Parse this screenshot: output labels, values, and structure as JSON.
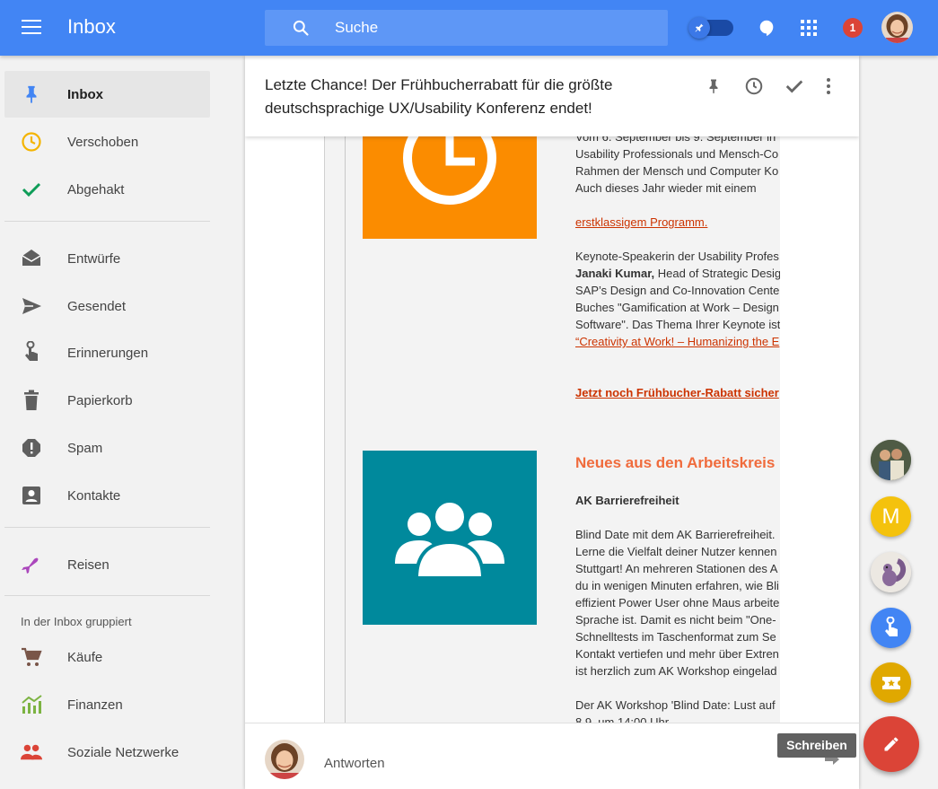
{
  "topbar": {
    "title": "Inbox",
    "search_placeholder": "Suche",
    "notification_count": "1",
    "colors": {
      "bar": "#4285f4",
      "search": "#5e97f6",
      "badge": "#db4437"
    }
  },
  "sidebar": {
    "items": [
      {
        "label": "Inbox",
        "icon": "pin-icon",
        "active": true
      },
      {
        "label": "Verschoben",
        "icon": "clock-icon"
      },
      {
        "label": "Abgehakt",
        "icon": "check-icon"
      },
      {
        "label": "Entwürfe",
        "icon": "drafts-icon"
      },
      {
        "label": "Gesendet",
        "icon": "send-icon"
      },
      {
        "label": "Erinnerungen",
        "icon": "reminder-icon"
      },
      {
        "label": "Papierkorb",
        "icon": "trash-icon"
      },
      {
        "label": "Spam",
        "icon": "spam-icon"
      },
      {
        "label": "Kontakte",
        "icon": "contacts-icon"
      },
      {
        "label": "Reisen",
        "icon": "plane-icon"
      },
      {
        "label": "Käufe",
        "icon": "cart-icon"
      },
      {
        "label": "Finanzen",
        "icon": "finance-icon"
      },
      {
        "label": "Soziale Netzwerke",
        "icon": "people-icon"
      }
    ],
    "group_label": "In der Inbox gruppiert"
  },
  "email": {
    "subject": "Letzte Chance! Der Frühbucherrabatt für die größte deutschsprachige UX/Usability Konferenz endet!",
    "body": {
      "p1_line1": "Vom 6. September bis 9. September in",
      "p1_line2": "Usability Professionals und Mensch-Co",
      "p1_line3": "Rahmen der Mensch und Computer Ko",
      "p1_line4": "Auch dieses Jahr wieder mit einem",
      "link_program": "erstklassigem Programm.",
      "p2_line1": "Keynote-Speakerin der Usability Profes",
      "p2_name": "Janaki Kumar,",
      "p2_line2_rest": " Head of Strategic Desig",
      "p2_line3": "SAP’s Design and Co-Innovation Cente",
      "p2_line4": "Buches \"Gamification at Work – Design",
      "p2_line5": "Software\". Das Thema Ihrer Keynote ist",
      "link_keynote": "“Creativity at Work! – Humanizing the E",
      "link_rabatt": "Jetzt noch Frühbucher-Rabatt sicher",
      "heading_news": "Neues aus den Arbeitskreis",
      "sub_ak": "AK Barrierefreiheit",
      "p3_line1": "Blind Date mit dem AK Barrierefreiheit.",
      "p3_line2": "Lerne die Vielfalt deiner Nutzer kennen",
      "p3_line3": "Stuttgart! An mehreren Stationen des A",
      "p3_line4": "du in wenigen Minuten erfahren, wie Bli",
      "p3_line5": "effizient Power User ohne Maus arbeite",
      "p3_line6": "Sprache ist. Damit es nicht beim \"One-",
      "p3_line7": "Schnelltests im Taschenformat zum Se",
      "p3_line8": "Kontakt vertiefen und mehr über Extren",
      "p3_line9": "ist herzlich zum AK Workshop eingelad",
      "p4_line1": "Der AK Workshop 'Blind Date: Lust auf",
      "p4_line2": "8.9. um 14:00 Uhr"
    },
    "reply_label": "Antworten",
    "colors": {
      "tile_orange": "#fb8c00",
      "tile_teal": "#00899c",
      "link": "#cc3300",
      "heading": "#f06b3c"
    }
  },
  "right_stack": {
    "m_letter": "M",
    "tooltip": "Schreiben",
    "colors": {
      "m": "#f4c20d",
      "reminder": "#4285f4",
      "ticket": "#e0a800",
      "compose": "#db4437"
    }
  }
}
